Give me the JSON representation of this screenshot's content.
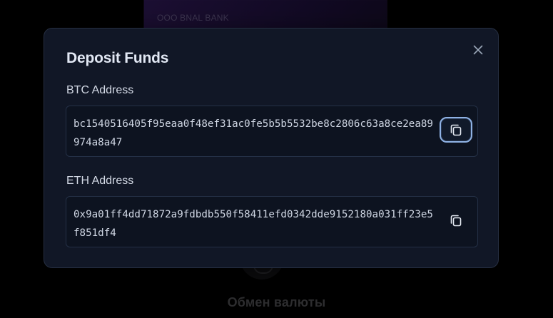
{
  "background": {
    "card_bank_name": "ООО BNAL BANK",
    "exchange_label": "Обмен валюты"
  },
  "modal": {
    "title": "Deposit Funds",
    "close_icon": "close-icon",
    "fields": [
      {
        "label": "BTC Address",
        "address": "bc1540516405f95eaa0f48ef31ac0fe5b5b5532be8c2806c63a8ce2ea89974a8a47",
        "copy_icon": "copy-icon",
        "copy_focused": true
      },
      {
        "label": "ETH Address",
        "address": "0x9a01ff4dd71872a9fdbdb550f58411efd0342dde9152180a031ff23e5f851df4",
        "copy_icon": "copy-icon",
        "copy_focused": false
      }
    ]
  },
  "colors": {
    "modal_bg": "#111726",
    "modal_border": "#262f42",
    "focus_ring": "#8fb2e4",
    "text_primary": "#e2e8f4"
  }
}
